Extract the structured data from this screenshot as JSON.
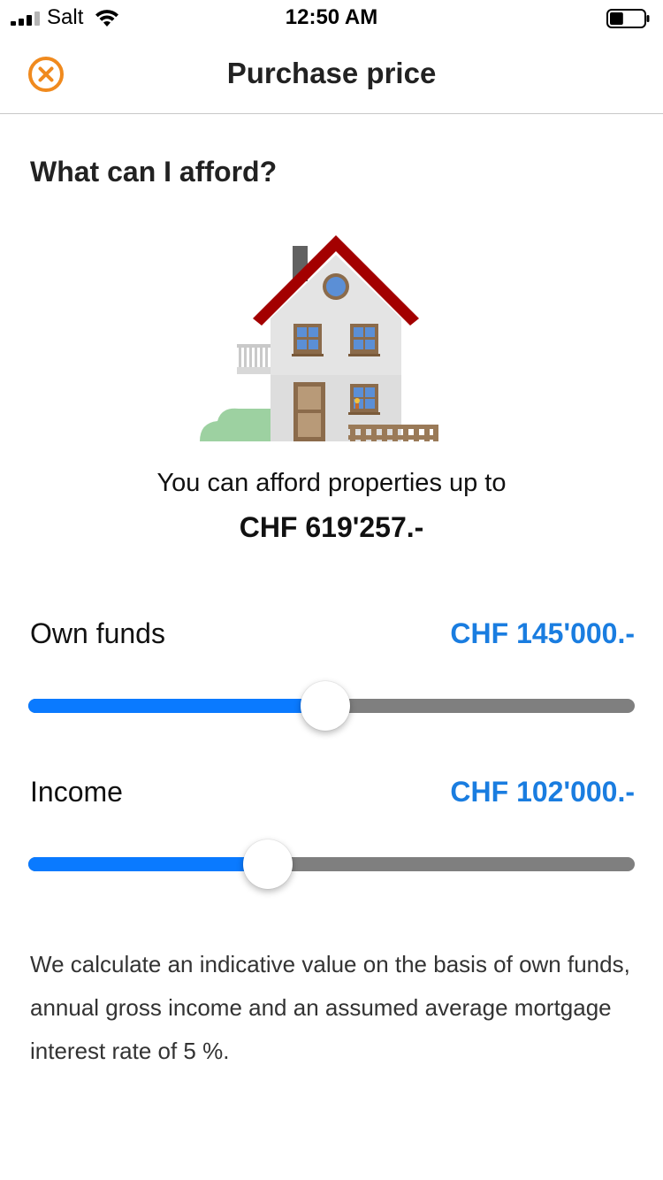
{
  "status_bar": {
    "carrier": "Salt",
    "time": "12:50 AM",
    "signal_bars_active": 3,
    "battery_level": 0.4
  },
  "nav": {
    "title": "Purchase price",
    "close_icon": "close-circle-icon",
    "accent_color": "#f08a1e"
  },
  "content": {
    "heading": "What can I afford?",
    "illustration": "house-icon",
    "afford_text": "You can afford properties up to",
    "afford_value": "CHF 619'257.-"
  },
  "sliders": [
    {
      "label": "Own funds",
      "value_text": "CHF 145'000.-",
      "position": 0.49
    },
    {
      "label": "Income",
      "value_text": "CHF 102'000.-",
      "position": 0.395
    }
  ],
  "disclaimer": "We calculate an indicative value on the basis of own funds, annual gross income and an assumed average mortgage interest rate of 5 %.",
  "colors": {
    "value_text": "#1a7de0",
    "slider_fill": "#0a7aff",
    "slider_track": "#7f7f7f"
  }
}
